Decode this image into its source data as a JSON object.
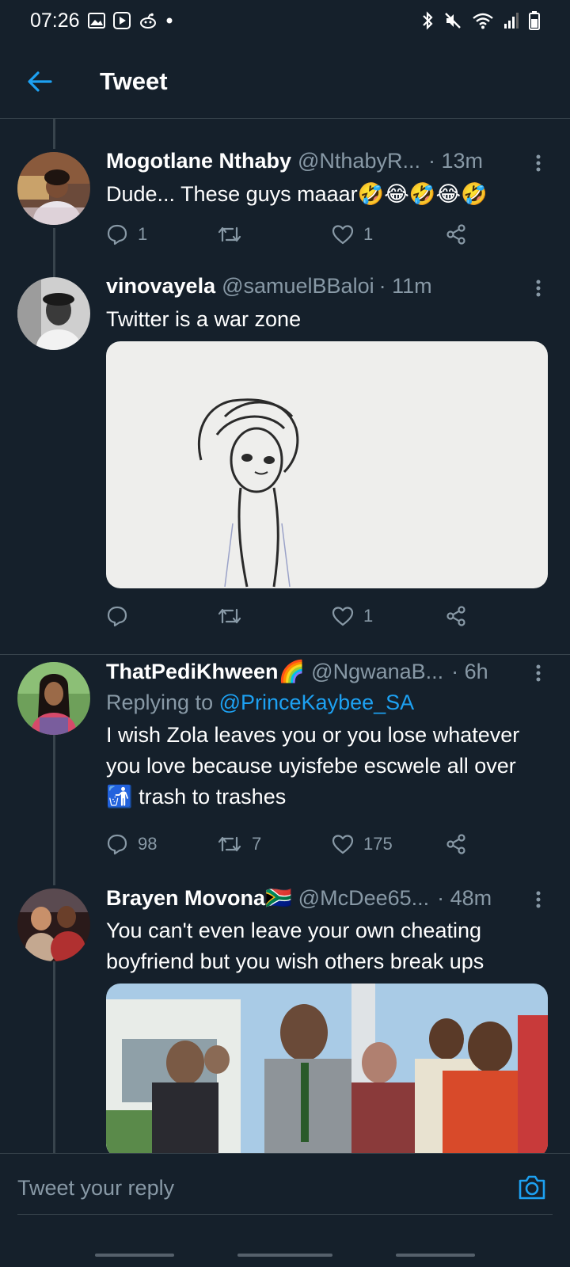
{
  "status_bar": {
    "time": "07:26"
  },
  "header": {
    "title": "Tweet"
  },
  "tweets": [
    {
      "name": "Mogotlane Nthaby",
      "handle": "@NthabyR...",
      "time": "· 13m",
      "text": "Dude... These guys maaar🤣😂🤣😂🤣",
      "replies": "1",
      "retweets": "",
      "likes": "1"
    },
    {
      "name": "vinovayela",
      "handle": "@samuelBBaloi",
      "time": "· 11m",
      "text": "Twitter is a war zone",
      "replies": "",
      "retweets": "",
      "likes": "1"
    },
    {
      "name": "ThatPediKhween🌈",
      "handle": "@NgwanaB...",
      "time": "· 6h",
      "replying_prefix": "Replying to",
      "replying_to": "@PrinceKaybee_SA",
      "text": "I wish Zola leaves you or you lose whatever you love because uyisfebe escwele all over 🚮 trash to trashes",
      "replies": "98",
      "retweets": "7",
      "likes": "175"
    },
    {
      "name": "Brayen Movona🇿🇦",
      "handle": "@McDee65...",
      "time": "· 48m",
      "text": "You can't even leave your own cheating boyfriend but you wish others  break ups"
    }
  ],
  "compose": {
    "placeholder": "Tweet your reply"
  },
  "icons": {
    "back": "arrow-left-icon",
    "reply": "speech-bubble-icon",
    "retweet": "retweet-icon",
    "like": "heart-icon",
    "share": "share-icon",
    "more": "more-vertical-icon",
    "camera": "camera-icon"
  },
  "colors": {
    "accent": "#1da1f2",
    "background": "#15202b",
    "muted": "#8899a6",
    "divider": "#38444d"
  }
}
